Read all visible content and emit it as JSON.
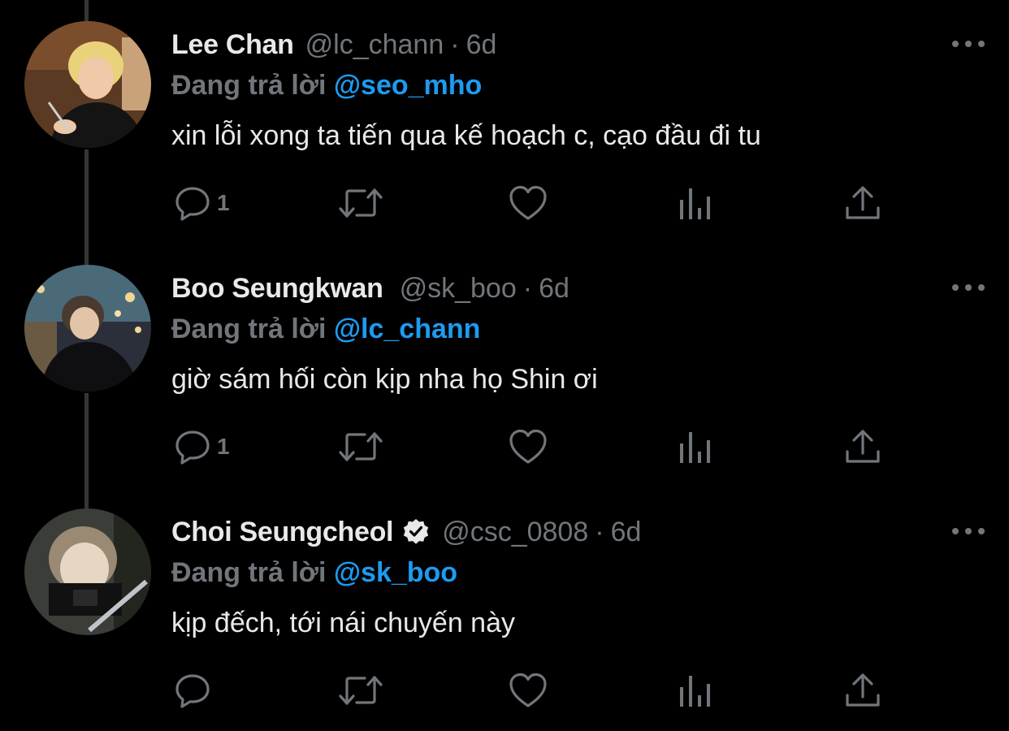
{
  "theme": {
    "background": "#000000",
    "text_primary": "#e7e9ea",
    "text_secondary": "#71767b",
    "accent": "#1d9bf0",
    "thread_line": "#333639"
  },
  "tweets": [
    {
      "name": "Lee Chan",
      "verified": false,
      "handle": "@lc_chann",
      "separator": "·",
      "time": "6d",
      "reply_prefix": "Đang trả lời",
      "reply_handle": "@seo_mho",
      "text": "xin lỗi xong ta tiến qua kế hoạch c, cạo đầu đi tu",
      "reply_count": "1",
      "icons": [
        "reply-icon",
        "retweet-icon",
        "like-icon",
        "analytics-icon",
        "share-icon",
        "more-icon"
      ]
    },
    {
      "name": "Boo Seungkwan",
      "verified": false,
      "handle": "@sk_boo",
      "separator": "·",
      "time": "6d",
      "reply_prefix": "Đang trả lời",
      "reply_handle": "@lc_chann",
      "text": "giờ sám hối còn kịp nha họ Shin ơi",
      "reply_count": "1",
      "icons": [
        "reply-icon",
        "retweet-icon",
        "like-icon",
        "analytics-icon",
        "share-icon",
        "more-icon"
      ]
    },
    {
      "name": "Choi Seungcheol",
      "verified": true,
      "handle": "@csc_0808",
      "separator": "·",
      "time": "6d",
      "reply_prefix": "Đang trả lời",
      "reply_handle": "@sk_boo",
      "text": "kịp đếch, tới nái chuyến này",
      "reply_count": "",
      "icons": [
        "reply-icon",
        "retweet-icon",
        "like-icon",
        "analytics-icon",
        "share-icon",
        "more-icon"
      ]
    }
  ]
}
